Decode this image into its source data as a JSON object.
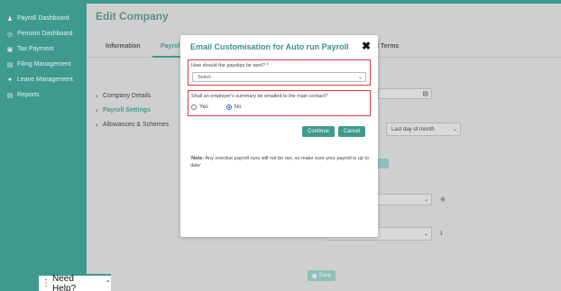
{
  "sidebar": {
    "items": [
      {
        "label": "Payroll Dashboard",
        "icon": "person-icon"
      },
      {
        "label": "Pension Dashboard",
        "icon": "pension-icon"
      },
      {
        "label": "Tax Payment",
        "icon": "card-icon"
      },
      {
        "label": "Filing Management",
        "icon": "document-icon"
      },
      {
        "label": "Leave Management",
        "icon": "leave-icon"
      },
      {
        "label": "Reports",
        "icon": "report-icon"
      }
    ]
  },
  "page": {
    "title": "Edit Company",
    "tabs": [
      {
        "label": "Information"
      },
      {
        "label": "Payrol"
      },
      {
        "label": "l Terms"
      }
    ],
    "left_nav": [
      {
        "label": "Company Details"
      },
      {
        "label": "Payroll Settings"
      },
      {
        "label": "Allowances & Schemes"
      }
    ],
    "bg_select_value": "Last day of month",
    "save_label": "Save"
  },
  "modal": {
    "title": "Email Customisation for Auto run Payroll",
    "close": "✖",
    "q1_label": "How should the payslips be sent? *",
    "q1_value": "-Select-",
    "q2_label": "Shall an employer's summary be emailed to the main contact?",
    "q2_yes": "Yes",
    "q2_no": "No",
    "continue_label": "Continue",
    "cancel_label": "Cancel",
    "note_bold": "Note:",
    "note_text": " Any overdue payroll runs will not be ran, so make sure your payroll is up to date'"
  },
  "help": {
    "label": "Need Help?"
  },
  "colors": {
    "brand": "#3f9a8e",
    "highlight": "#d93a3a"
  }
}
